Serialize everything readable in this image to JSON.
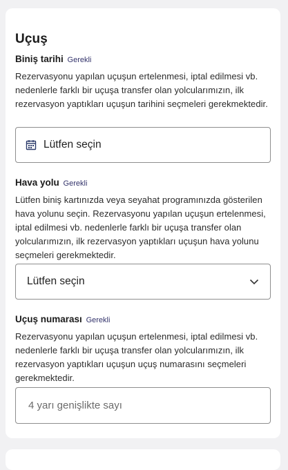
{
  "section": {
    "title": "Uçuş"
  },
  "fields": {
    "date": {
      "label": "Biniş tarihi",
      "required": "Gerekli",
      "description": "Rezervasyonu yapılan uçuşun ertelenmesi, iptal edilmesi vb. nedenlerle farklı bir uçuşa transfer olan yolcularımızın, ilk rezervasyon yaptıkları uçuşun tarihini seçmeleri gerekmektedir.",
      "value": "Lütfen seçin",
      "icon": "calendar-icon"
    },
    "airline": {
      "label": "Hava yolu",
      "required": "Gerekli",
      "description": "Lütfen biniş kartınızda veya seyahat programınızda gösterilen hava yolunu seçin. Rezervasyonu yapılan uçuşun ertelenmesi, iptal edilmesi vb. nedenlerle farklı bir uçuşa transfer olan yolcularımızın, ilk rezervasyon yaptıkları uçuşun hava yolunu seçmeleri gerekmektedir.",
      "value": "Lütfen seçin",
      "icon": "chevron-down-icon"
    },
    "flight_number": {
      "label": "Uçuş numarası",
      "required": "Gerekli",
      "description": "Rezervasyonu yapılan uçuşun ertelenmesi, iptal edilmesi vb. nedenlerle farklı bir uçuşa transfer olan yolcularımızın, ilk rezervasyon yaptıkları uçuşun uçuş numarasını seçmeleri gerekmektedir.",
      "placeholder": "4 yarı genişlikte sayı",
      "value": ""
    }
  }
}
